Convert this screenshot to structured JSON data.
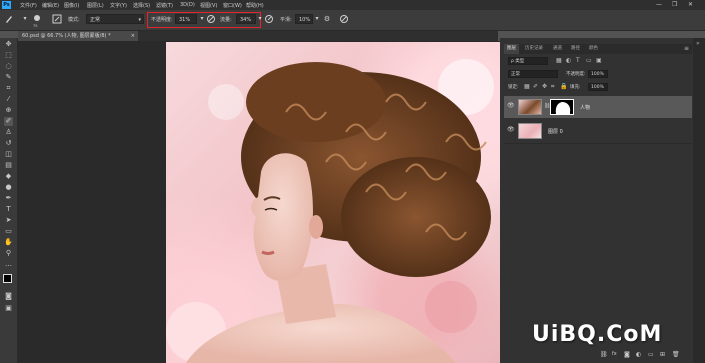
{
  "app": {
    "logo": "Ps"
  },
  "menubar": {
    "items": [
      "文件(F)",
      "编辑(E)",
      "图像(I)",
      "图层(L)",
      "文字(Y)",
      "选择(S)",
      "滤镜(T)",
      "3D(D)",
      "视图(V)",
      "窗口(W)",
      "帮助(H)"
    ],
    "window_controls": [
      "—",
      "❐",
      "✕"
    ]
  },
  "options": {
    "brush_size": "75",
    "mode_label": "模式:",
    "mode_value": "正常",
    "opacity_label": "不透明度:",
    "opacity_value": "31%",
    "flow_label": "流量:",
    "flow_value": "34%",
    "smooth_label": "平滑:",
    "smooth_value": "10%",
    "highlight_color": "#e0262a"
  },
  "document": {
    "tab_title": "60.psd @ 66.7% (人物, 图层蒙版/8) *",
    "tab_close": "×"
  },
  "panel": {
    "tabs": [
      "图层",
      "历史记录",
      "通道",
      "路径",
      "颜色"
    ],
    "filter_kind": "ρ 类型",
    "blend_mode": "正常",
    "opacity_label": "不透明度:",
    "opacity_value": "100%",
    "lock_label": "锁定:",
    "fill_label": "填充:",
    "fill_value": "100%",
    "layers": [
      {
        "name": "人物",
        "visible": true,
        "selected": true
      },
      {
        "name": "图层 0",
        "visible": true,
        "selected": false
      }
    ],
    "bottom_icons": [
      "link-icon",
      "fx-icon",
      "mask-icon",
      "adjust-icon",
      "folder-icon",
      "new-layer-icon",
      "trash-icon"
    ]
  },
  "watermark": "UiBQ.CoM",
  "colors": {
    "menubar": "#2f2f2f",
    "optbar": "#3c3c3c",
    "workspace": "#2a2a2a",
    "panel": "#323232",
    "accent_ps": "#31a8ff"
  }
}
